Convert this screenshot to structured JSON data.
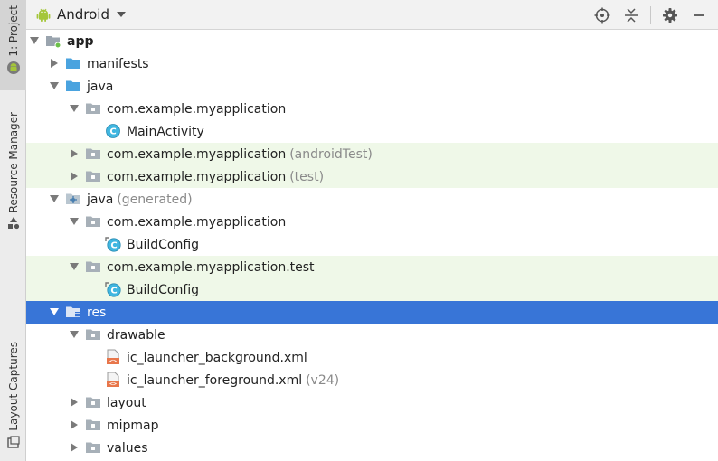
{
  "strip": {
    "project_label": "1: Project",
    "resource_label": "Resource Manager",
    "layout_label": "Layout Captures"
  },
  "header": {
    "view_label": "Android"
  },
  "tree": [
    {
      "label": "app",
      "secondary": "",
      "depth": 0,
      "icon": "module",
      "expanded": true,
      "has_children": true,
      "bold": true,
      "highlight": ""
    },
    {
      "label": "manifests",
      "secondary": "",
      "depth": 1,
      "icon": "folder-blue",
      "expanded": false,
      "has_children": true,
      "bold": false,
      "highlight": ""
    },
    {
      "label": "java",
      "secondary": "",
      "depth": 1,
      "icon": "folder-blue",
      "expanded": true,
      "has_children": true,
      "bold": false,
      "highlight": ""
    },
    {
      "label": "com.example.myapplication",
      "secondary": "",
      "depth": 2,
      "icon": "package",
      "expanded": true,
      "has_children": true,
      "bold": false,
      "highlight": ""
    },
    {
      "label": "MainActivity",
      "secondary": "",
      "depth": 3,
      "icon": "class",
      "expanded": false,
      "has_children": false,
      "bold": false,
      "highlight": ""
    },
    {
      "label": "com.example.myapplication",
      "secondary": "(androidTest)",
      "depth": 2,
      "icon": "package",
      "expanded": false,
      "has_children": true,
      "bold": false,
      "highlight": "green"
    },
    {
      "label": "com.example.myapplication",
      "secondary": "(test)",
      "depth": 2,
      "icon": "package",
      "expanded": false,
      "has_children": true,
      "bold": false,
      "highlight": "green"
    },
    {
      "label": "java",
      "secondary": "(generated)",
      "depth": 1,
      "icon": "folder-generated",
      "expanded": true,
      "has_children": true,
      "bold": false,
      "highlight": ""
    },
    {
      "label": "com.example.myapplication",
      "secondary": "",
      "depth": 2,
      "icon": "package",
      "expanded": true,
      "has_children": true,
      "bold": false,
      "highlight": ""
    },
    {
      "label": "BuildConfig",
      "secondary": "",
      "depth": 3,
      "icon": "class-locked",
      "expanded": false,
      "has_children": false,
      "bold": false,
      "highlight": ""
    },
    {
      "label": "com.example.myapplication.test",
      "secondary": "",
      "depth": 2,
      "icon": "package",
      "expanded": true,
      "has_children": true,
      "bold": false,
      "highlight": "green"
    },
    {
      "label": "BuildConfig",
      "secondary": "",
      "depth": 3,
      "icon": "class-locked",
      "expanded": false,
      "has_children": false,
      "bold": false,
      "highlight": "green"
    },
    {
      "label": "res",
      "secondary": "",
      "depth": 1,
      "icon": "folder-res",
      "expanded": true,
      "has_children": true,
      "bold": false,
      "highlight": "selected"
    },
    {
      "label": "drawable",
      "secondary": "",
      "depth": 2,
      "icon": "package",
      "expanded": true,
      "has_children": true,
      "bold": false,
      "highlight": ""
    },
    {
      "label": "ic_launcher_background.xml",
      "secondary": "",
      "depth": 3,
      "icon": "xml-file",
      "expanded": false,
      "has_children": false,
      "bold": false,
      "highlight": ""
    },
    {
      "label": "ic_launcher_foreground.xml",
      "secondary": "(v24)",
      "depth": 3,
      "icon": "xml-file",
      "expanded": false,
      "has_children": false,
      "bold": false,
      "highlight": ""
    },
    {
      "label": "layout",
      "secondary": "",
      "depth": 2,
      "icon": "package",
      "expanded": false,
      "has_children": true,
      "bold": false,
      "highlight": ""
    },
    {
      "label": "mipmap",
      "secondary": "",
      "depth": 2,
      "icon": "package",
      "expanded": false,
      "has_children": true,
      "bold": false,
      "highlight": ""
    },
    {
      "label": "values",
      "secondary": "",
      "depth": 2,
      "icon": "package",
      "expanded": false,
      "has_children": true,
      "bold": false,
      "highlight": ""
    }
  ],
  "colors": {
    "selection": "#3875d7",
    "test_highlight": "#eff8e8",
    "android_green": "#a4c639",
    "folder_blue": "#4aa3df",
    "class_circle": "#40b6e0"
  }
}
